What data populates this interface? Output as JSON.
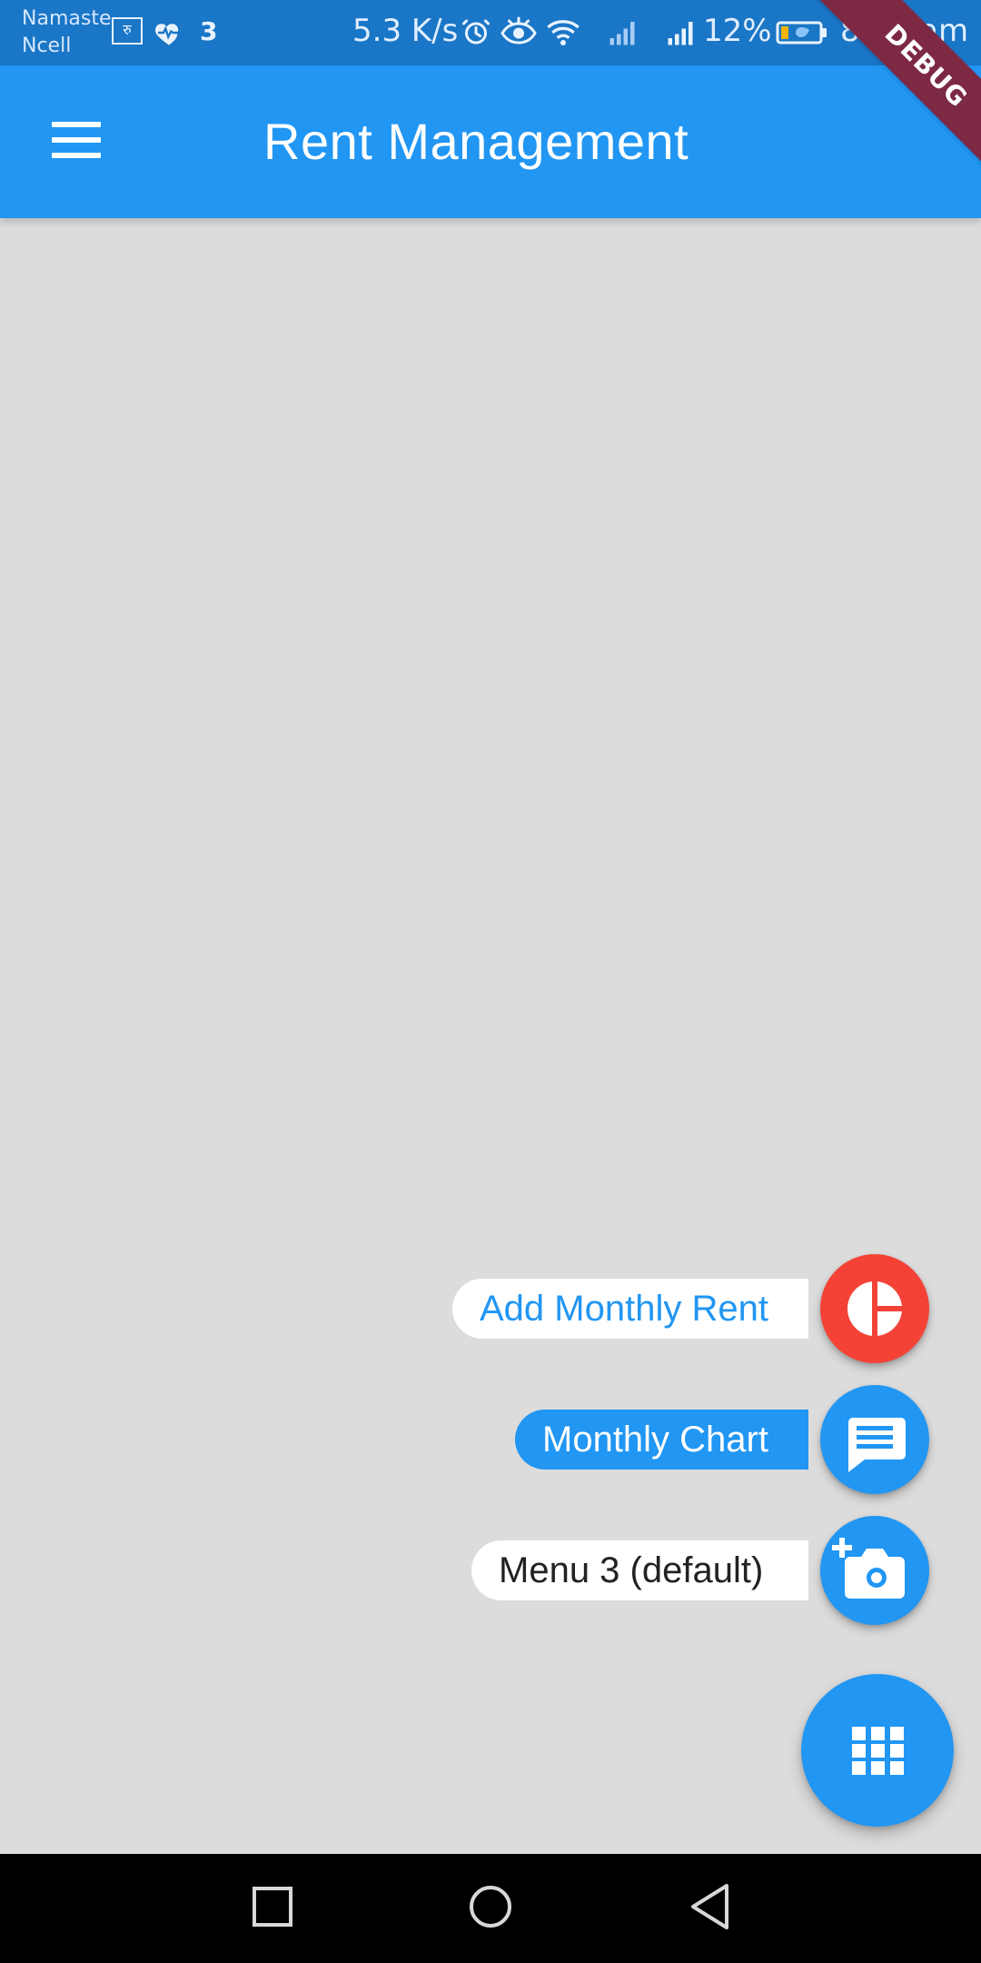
{
  "status_bar": {
    "carrier_line1": "Namaste",
    "carrier_line2": "Ncell",
    "currency_badge": "रु",
    "notification_count": "3",
    "speed": "5.3 K/s",
    "battery": "12%",
    "time": "8:47 am"
  },
  "app_bar": {
    "title": "Rent Management"
  },
  "debug_banner": "DEBUG",
  "speed_dial": {
    "items": [
      {
        "label": "Add Monthly Rent",
        "icon": "pie-chart-icon",
        "accent": "#F44336"
      },
      {
        "label": "Monthly Chart",
        "icon": "message-icon",
        "accent": "#2196F3"
      },
      {
        "label": "Menu 3 (default)",
        "icon": "add-camera-icon",
        "accent": "#2196F3"
      }
    ],
    "main_icon": "apps-grid-icon"
  },
  "navigation_bar": {
    "buttons": [
      "recents-icon",
      "home-icon",
      "back-icon"
    ]
  },
  "colors": {
    "status_bar": "#1A76C6",
    "app_bar": "#2196F3",
    "background": "#DCDCDC",
    "debug": "#7D2944",
    "nav_bar": "#000000"
  }
}
